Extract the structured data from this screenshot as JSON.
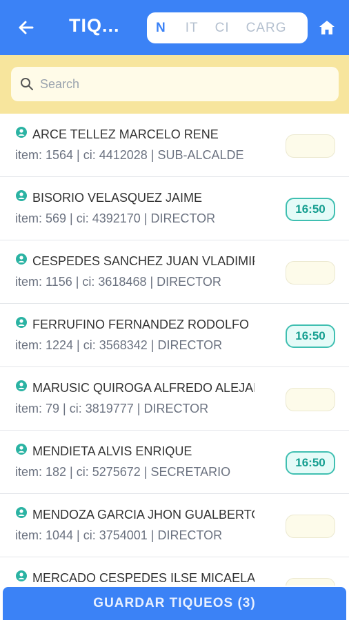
{
  "header": {
    "back_icon": "arrow-left-icon",
    "title": "TIQ...",
    "segments": [
      "N",
      "IT",
      "CI",
      "CARG"
    ],
    "active_segment": "N",
    "home_icon": "home-icon",
    "color": "#3b82f6"
  },
  "search": {
    "placeholder": "Search",
    "value": "",
    "icon": "search-icon"
  },
  "list": {
    "items": [
      {
        "name": "ARCE TELLEZ MARCELO RENE",
        "detail": "item: 1564 | ci: 4412028 | SUB-ALCALDE",
        "time": ""
      },
      {
        "name": "BISORIO VELASQUEZ JAIME",
        "detail": "item: 569 | ci: 4392170 | DIRECTOR",
        "time": "16:50"
      },
      {
        "name": "CESPEDES SANCHEZ JUAN VLADIMIR",
        "detail": "item: 1156 | ci: 3618468 | DIRECTOR",
        "time": ""
      },
      {
        "name": "FERRUFINO FERNANDEZ RODOLFO",
        "detail": "item: 1224 | ci: 3568342 | DIRECTOR",
        "time": "16:50"
      },
      {
        "name": "MARUSIC QUIROGA ALFREDO ALEJANDRO",
        "detail": "item: 79 | ci: 3819777 | DIRECTOR",
        "time": ""
      },
      {
        "name": "MENDIETA ALVIS ENRIQUE",
        "detail": "item: 182 | ci: 5275672 | SECRETARIO",
        "time": "16:50"
      },
      {
        "name": "MENDOZA GARCIA JHON GUALBERTO",
        "detail": "item: 1044 | ci: 3754001 | DIRECTOR",
        "time": ""
      },
      {
        "name": "MERCADO CESPEDES ILSE MICAELA",
        "detail": "",
        "time": ""
      }
    ]
  },
  "footer": {
    "save_label": "GUARDAR TIQUEOS (3)"
  }
}
